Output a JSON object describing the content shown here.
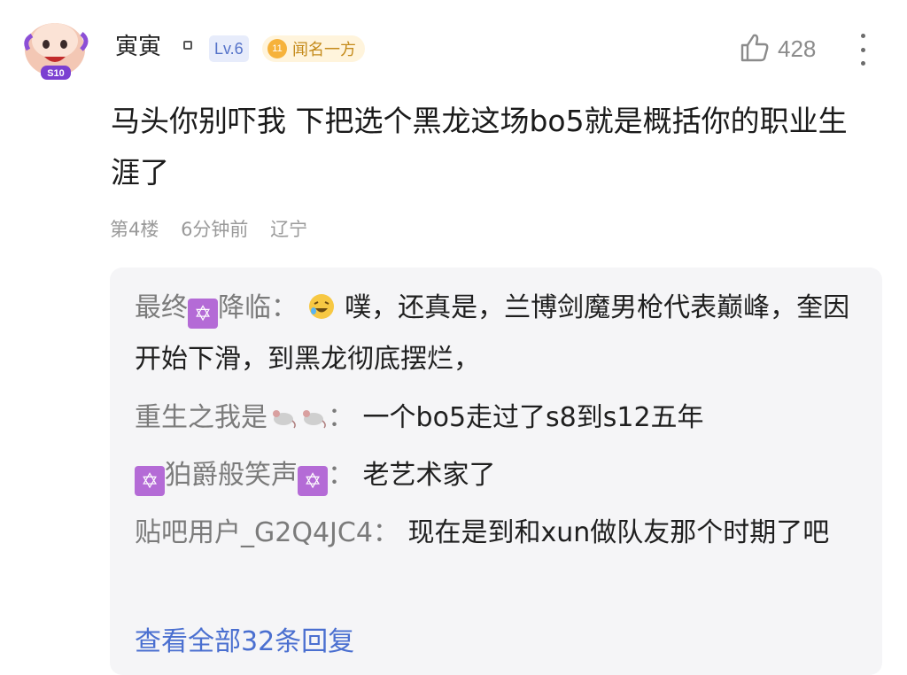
{
  "comment": {
    "username": "寅寅",
    "level": "Lv.6",
    "title_badge": {
      "number": "11",
      "label": "闻名一方"
    },
    "likes": "428",
    "content": "马头你别吓我 下把选个黑龙这场bo5就是概括你的职业生涯了",
    "floor": "第4楼",
    "time": "6分钟前",
    "location": "辽宁"
  },
  "replies": [
    {
      "author_pre": "最终",
      "author_post": "降临",
      "sep": "：",
      "text": "噗，还真是，兰博剑魔男枪代表巅峰，奎因开始下滑，到黑龙彻底摆烂，"
    },
    {
      "author_pre": "重生之我是",
      "sep": "：",
      "text": "一个bo5走过了s8到s12五年"
    },
    {
      "author_mid": "狛爵般笑声",
      "sep": "：",
      "text": "老艺术家了"
    },
    {
      "author_pre": "贴吧用户_G2Q4JC4",
      "sep": "：",
      "text": "现在是到和xun做队友那个时期了吧"
    }
  ],
  "view_all": "查看全部32条回复",
  "colors": {
    "accent_link": "#4a6fd0",
    "level_bg": "#e7ecfb",
    "badge_bg": "#fff4dc",
    "reply_bg": "#f5f5f7"
  },
  "icons": [
    "avatar",
    "gender-icon",
    "like-icon",
    "more-icon",
    "hexagram-icon",
    "rat-icon",
    "laughing-emoji-icon"
  ]
}
